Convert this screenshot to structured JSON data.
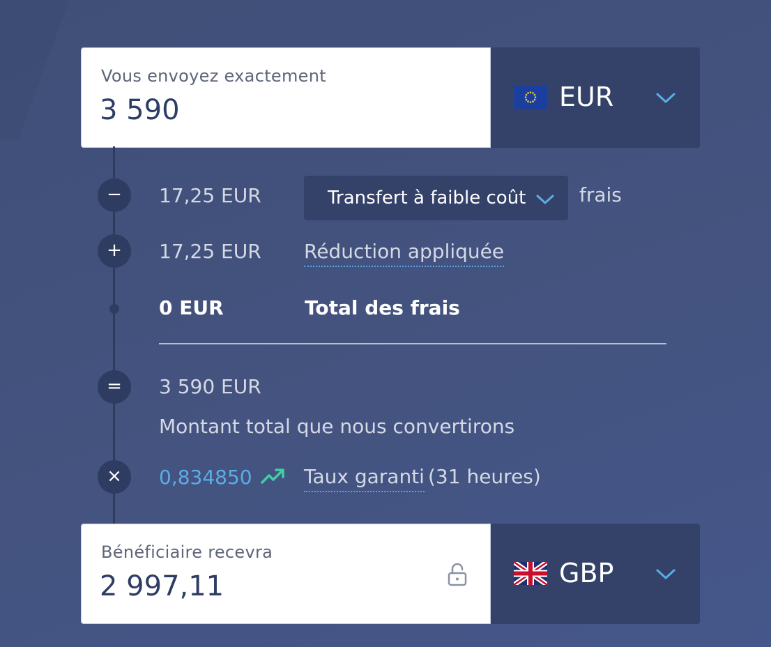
{
  "send": {
    "label": "Vous envoyez exactement",
    "amount": "3 590",
    "currency": "EUR",
    "flag_icon": "eu-flag-icon",
    "chevron_icon": "chevron-down-icon"
  },
  "fees": {
    "fee_amount": "17,25 EUR",
    "fee_type": "Transfert à faible coût",
    "fee_suffix": "frais",
    "discount_amount": "17,25 EUR",
    "discount_label": "Réduction appliquée",
    "total_amount": "0 EUR",
    "total_label": "Total des frais"
  },
  "conversion": {
    "converted_amount": "3 590 EUR",
    "converted_label": "Montant total que nous convertirons",
    "rate": "0,834850",
    "rate_label": "Taux garanti",
    "rate_duration": " (31 heures)"
  },
  "receive": {
    "label": "Bénéficiaire recevra",
    "amount": "2 997,11",
    "currency": "GBP",
    "flag_icon": "uk-flag-icon",
    "lock_icon": "unlock-icon"
  },
  "symbols": {
    "minus": "−",
    "plus": "+",
    "equals": "=",
    "times": "×"
  },
  "colors": {
    "background": "#44537f",
    "panel": "#34426a",
    "accent_blue": "#5aaee6",
    "trend_green": "#3fd0a0"
  }
}
